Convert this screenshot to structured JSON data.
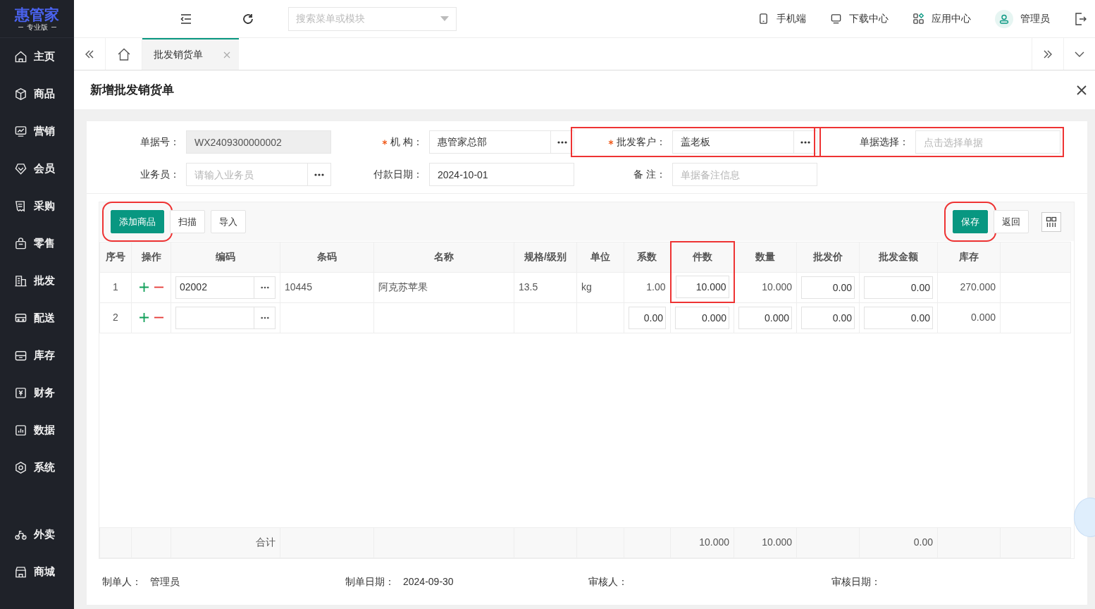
{
  "logo": {
    "name": "惠管家",
    "edition": "专业版"
  },
  "sidebar": {
    "items": [
      {
        "label": "主页"
      },
      {
        "label": "商品"
      },
      {
        "label": "营销"
      },
      {
        "label": "会员"
      },
      {
        "label": "采购"
      },
      {
        "label": "零售"
      },
      {
        "label": "批发"
      },
      {
        "label": "配送"
      },
      {
        "label": "库存"
      },
      {
        "label": "财务"
      },
      {
        "label": "数据"
      },
      {
        "label": "系统"
      }
    ],
    "bottom_items": [
      {
        "label": "外卖"
      },
      {
        "label": "商城"
      }
    ]
  },
  "topbar": {
    "search_placeholder": "搜索菜单或模块",
    "links": [
      {
        "label": "手机端"
      },
      {
        "label": "下载中心"
      },
      {
        "label": "应用中心"
      }
    ],
    "user": "管理员"
  },
  "tabs": [
    {
      "label": "批发销货单",
      "selected": true
    }
  ],
  "page": {
    "title": "新增批发销货单"
  },
  "form": {
    "fields": [
      {
        "label": "单据号：",
        "required": false,
        "value": "WX2409300000002",
        "disabled": true,
        "lookup": false,
        "highlighted": false
      },
      {
        "label": "机 构：",
        "required": true,
        "value": "惠管家总部",
        "disabled": false,
        "lookup": true,
        "highlighted": false
      },
      {
        "label": "批发客户：",
        "required": true,
        "value": "盖老板",
        "disabled": false,
        "lookup": true,
        "highlighted": true
      },
      {
        "label": "单据选择：",
        "required": false,
        "placeholder": "点击选择单据",
        "disabled": false,
        "lookup": false,
        "highlighted": true
      },
      {
        "label": "业务员：",
        "required": false,
        "placeholder": "请输入业务员",
        "disabled": false,
        "lookup": true,
        "highlighted": false
      },
      {
        "label": "付款日期：",
        "required": false,
        "value": "2024-10-01",
        "disabled": false,
        "lookup": false,
        "highlighted": false
      },
      {
        "label": "备 注：",
        "required": false,
        "placeholder": "单据备注信息",
        "disabled": false,
        "lookup": false,
        "highlighted": false
      }
    ]
  },
  "toolbar": {
    "left": [
      {
        "label": "添加商品",
        "kind": "primary",
        "highlighted": true
      },
      {
        "label": "扫描",
        "kind": "default",
        "highlighted": false
      },
      {
        "label": "导入",
        "kind": "default",
        "highlighted": false
      }
    ],
    "right": [
      {
        "label": "保存",
        "kind": "primary",
        "highlighted": true
      },
      {
        "label": "返回",
        "kind": "default",
        "highlighted": false
      }
    ]
  },
  "table": {
    "columns": [
      {
        "label": "序号",
        "highlighted": false
      },
      {
        "label": "操作",
        "highlighted": false
      },
      {
        "label": "编码",
        "highlighted": false,
        "total": "合计"
      },
      {
        "label": "条码",
        "highlighted": false
      },
      {
        "label": "名称",
        "highlighted": false
      },
      {
        "label": "规格/级别",
        "highlighted": false
      },
      {
        "label": "单位",
        "highlighted": false
      },
      {
        "label": "系数",
        "highlighted": false
      },
      {
        "label": "件数",
        "highlighted": true,
        "total": "10.000"
      },
      {
        "label": "数量",
        "highlighted": false,
        "total": "10.000"
      },
      {
        "label": "批发价",
        "highlighted": false
      },
      {
        "label": "批发金额",
        "highlighted": false,
        "total": "0.00"
      },
      {
        "label": "库存",
        "highlighted": false
      }
    ],
    "rows": [
      {
        "cells": [
          {
            "kind": "text",
            "text": "1"
          },
          {
            "kind": "actions"
          },
          {
            "kind": "lookup",
            "value": "02002"
          },
          {
            "kind": "text",
            "text": "10445"
          },
          {
            "kind": "text",
            "text": "阿克苏苹果"
          },
          {
            "kind": "text",
            "text": "13.5"
          },
          {
            "kind": "text",
            "text": "kg"
          },
          {
            "kind": "text",
            "text": "1.00"
          },
          {
            "kind": "input",
            "value": "10.000",
            "highlighted": true
          },
          {
            "kind": "text",
            "text": "10.000"
          },
          {
            "kind": "input",
            "value": "0.00"
          },
          {
            "kind": "input",
            "value": "0.00"
          },
          {
            "kind": "text",
            "text": "270.000"
          }
        ]
      },
      {
        "cells": [
          {
            "kind": "text",
            "text": "2"
          },
          {
            "kind": "actions"
          },
          {
            "kind": "lookup"
          },
          {
            "kind": "empty"
          },
          {
            "kind": "empty"
          },
          {
            "kind": "empty"
          },
          {
            "kind": "empty"
          },
          {
            "kind": "input",
            "value": "0.00"
          },
          {
            "kind": "input",
            "value": "0.000"
          },
          {
            "kind": "input",
            "value": "0.000"
          },
          {
            "kind": "input",
            "value": "0.00"
          },
          {
            "kind": "input",
            "value": "0.00"
          },
          {
            "kind": "text",
            "text": "0.000"
          }
        ]
      }
    ]
  },
  "footer": [
    {
      "label": "制单人：",
      "value": "管理员"
    },
    {
      "label": "制单日期：",
      "value": "2024-09-30"
    },
    {
      "label": "审核人："
    },
    {
      "label": "审核日期："
    }
  ]
}
